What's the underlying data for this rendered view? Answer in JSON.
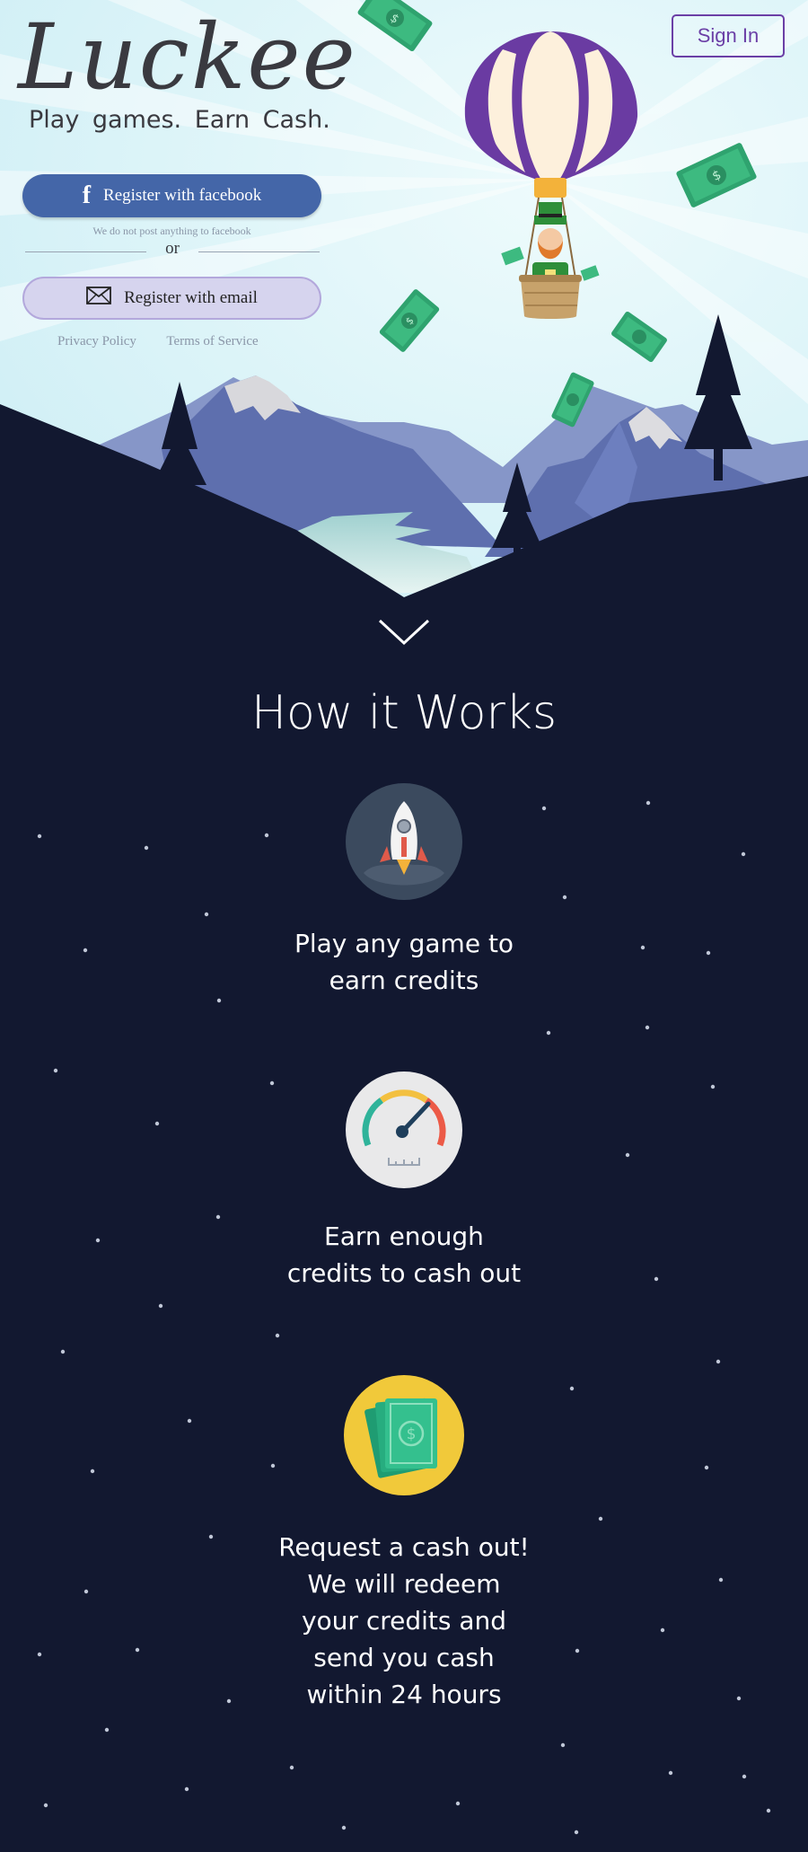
{
  "brand": {
    "logo": "Luckee",
    "tagline": "Play games.  Earn Cash."
  },
  "header": {
    "signin_label": "Sign In"
  },
  "register": {
    "facebook_label": "Register with facebook",
    "facebook_note": "We do not post anything to facebook",
    "or_label": "or",
    "email_label": "Register with email"
  },
  "footer_links": {
    "privacy": "Privacy Policy",
    "terms": "Terms of Service"
  },
  "how": {
    "title": "How it Works",
    "steps": [
      {
        "icon": "rocket-icon",
        "text": [
          "Play any game to",
          "earn credits"
        ]
      },
      {
        "icon": "speedometer-icon",
        "text": [
          "Earn enough",
          "credits to cash out"
        ]
      },
      {
        "icon": "cash-icon",
        "text": [
          "Request a cash out!",
          "We will redeem",
          "your credits  and",
          "send you cash",
          "within 24 hours"
        ]
      }
    ]
  },
  "colors": {
    "night": "#121830",
    "sky": "#dff4f8",
    "brand_purple": "#6b3fa6",
    "facebook": "#4466a8"
  }
}
